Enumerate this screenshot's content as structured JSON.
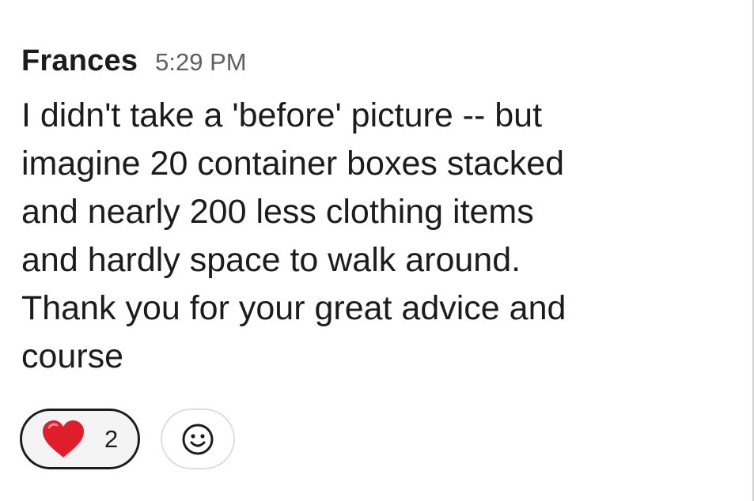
{
  "message": {
    "sender": "Frances",
    "timestamp": "5:29 PM",
    "lines": [
      "I didn't take a 'before' picture -- but",
      "imagine 20 container boxes stacked",
      "and nearly 200 less clothing items",
      "and hardly space to walk around.",
      "Thank you for your great advice and",
      "course"
    ]
  },
  "reactions": {
    "items": [
      {
        "icon": "heart-icon",
        "count": "2"
      }
    ],
    "add_icon": "smiley-face-icon"
  },
  "colors": {
    "heart": "#e01e2b",
    "text": "#1d1c1d",
    "timestamp": "#616061",
    "pill_border": "#1d1c1d",
    "pill_background": "#f4f4f4"
  }
}
